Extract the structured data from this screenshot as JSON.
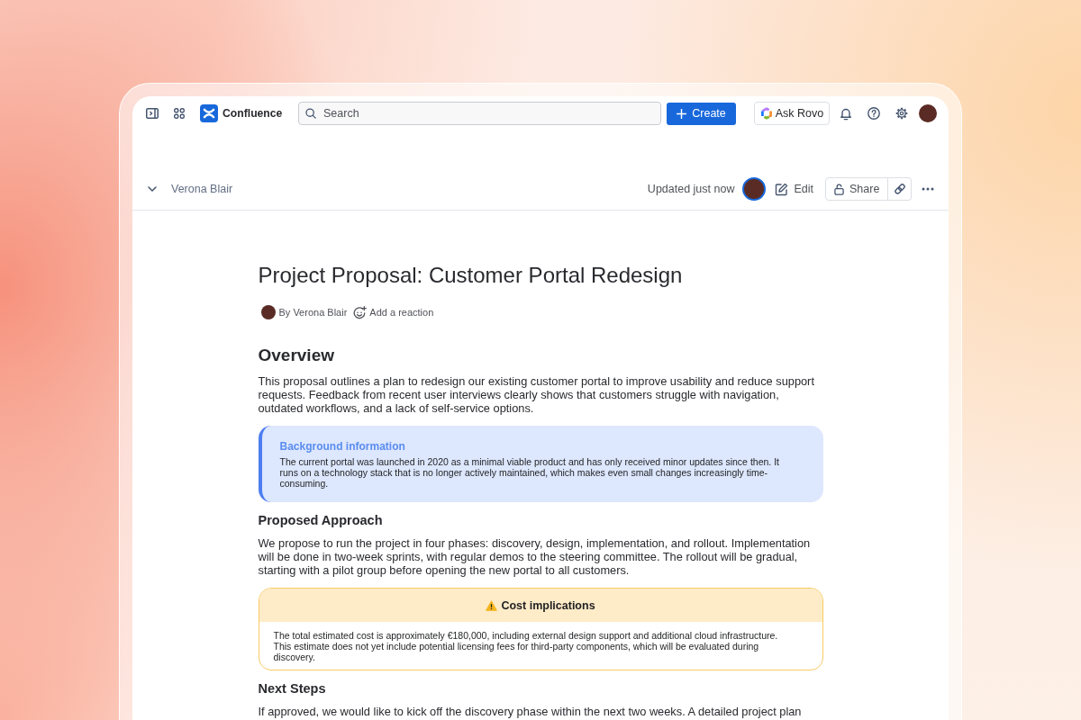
{
  "top_nav": {
    "product": "Confluence",
    "search": {
      "placeholder": "Search"
    },
    "create_button": "Create",
    "rovo_button": "Ask Rovo"
  },
  "page_header": {
    "author": "Verona Blair",
    "status": "Updated just now",
    "edit_button": "Edit",
    "share_button": "Share"
  },
  "document": {
    "title": "Project Proposal: Customer Portal Redesign",
    "byline": "By Verona Blair",
    "reaction_button": "Add a reaction",
    "blocks": [
      {
        "kind": "heading",
        "text": "Overview"
      },
      {
        "kind": "paragraph",
        "text": "This proposal outlines a plan to redesign our existing customer portal to improve usability and reduce support requests. Feedback from recent user interviews clearly shows that customers struggle with navigation, outdated workflows, and a lack of self-service options."
      },
      {
        "kind": "info",
        "title": "Background information",
        "text": "The current portal was launched in 2020 as a minimal viable product and has only received minor updates since then. It runs on a technology stack that is no longer actively maintained, which makes even small changes increasingly time-consuming."
      },
      {
        "kind": "subheading",
        "text": "Proposed Approach"
      },
      {
        "kind": "paragraph",
        "text": "We propose to run the project in four phases: discovery, design, implementation, and rollout. Implementation will be done in two-week sprints, with regular demos to the steering committee. The rollout will be gradual, starting with a pilot group before opening the new portal to all customers."
      },
      {
        "kind": "warning",
        "title": "Cost implications",
        "text": "The total estimated cost is approximately €180,000, including external design support and additional cloud infrastructure. This estimate does not yet include potential licensing fees for third-party components, which will be evaluated during discovery."
      },
      {
        "kind": "subheading",
        "text": "Next Steps"
      },
      {
        "kind": "paragraph",
        "text": "If approved, we would like to kick off the discovery phase within the next two weeks. A detailed project plan"
      }
    ]
  }
}
